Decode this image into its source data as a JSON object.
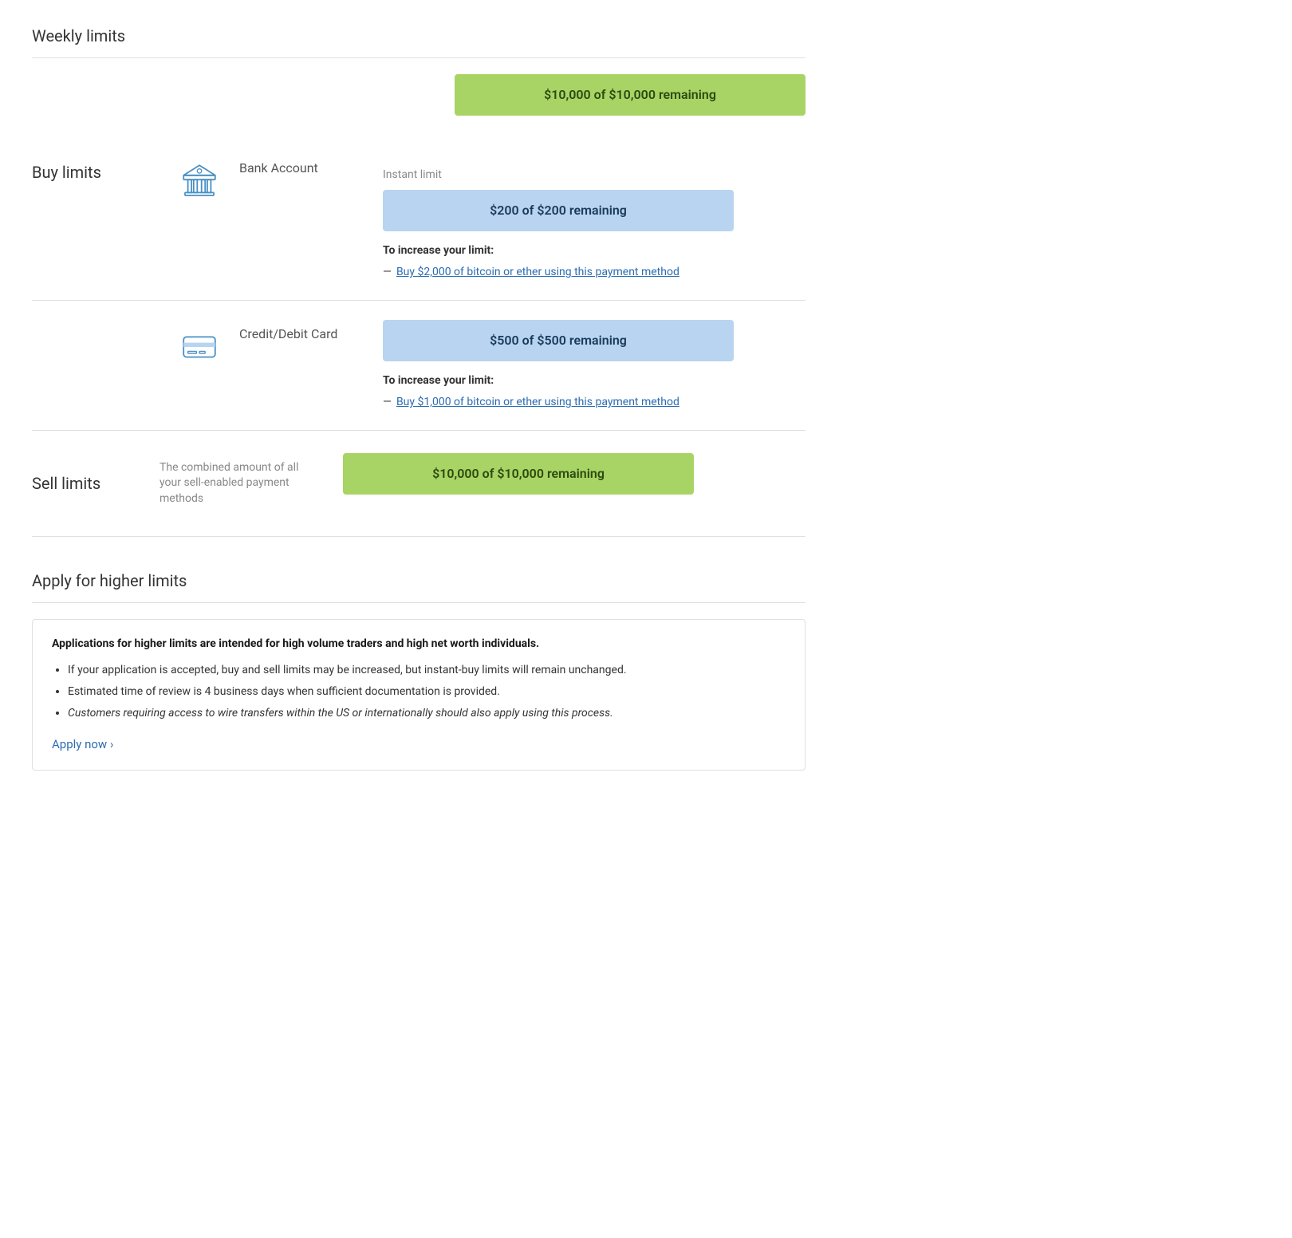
{
  "page": {
    "weekly_limits_title": "Weekly limits",
    "apply_section_title": "Apply for higher limits"
  },
  "buy_limits": {
    "label": "Buy limits",
    "global_bar": "$10,000 of $10,000 remaining",
    "bank_account": {
      "name": "Bank Account",
      "instant_limit_label": "Instant limit",
      "instant_bar": "$200 of $200 remaining",
      "increase_label": "To increase your limit:",
      "increase_prefix": "—",
      "increase_link": "Buy $2,000 of bitcoin or ether using this payment method"
    },
    "credit_debit": {
      "name": "Credit/Debit Card",
      "bar": "$500 of $500 remaining",
      "increase_label": "To increase your limit:",
      "increase_prefix": "—",
      "increase_link": "Buy $1,000 of bitcoin or ether using this payment method"
    }
  },
  "sell_limits": {
    "label": "Sell limits",
    "description": "The combined amount of all your sell-enabled payment methods",
    "bar": "$10,000 of $10,000 remaining"
  },
  "apply_higher": {
    "title": "Apply for higher limits",
    "bold_text": "Applications for higher limits are intended for high volume traders and high net worth individuals.",
    "bullets": [
      "If your application is accepted, buy and sell limits may be increased, but instant-buy limits will remain unchanged.",
      "Estimated time of review is 4 business days when sufficient documentation is provided.",
      "Customers requiring access to wire transfers within the US or internationally should also apply using this process."
    ],
    "apply_link": "Apply now ›"
  }
}
